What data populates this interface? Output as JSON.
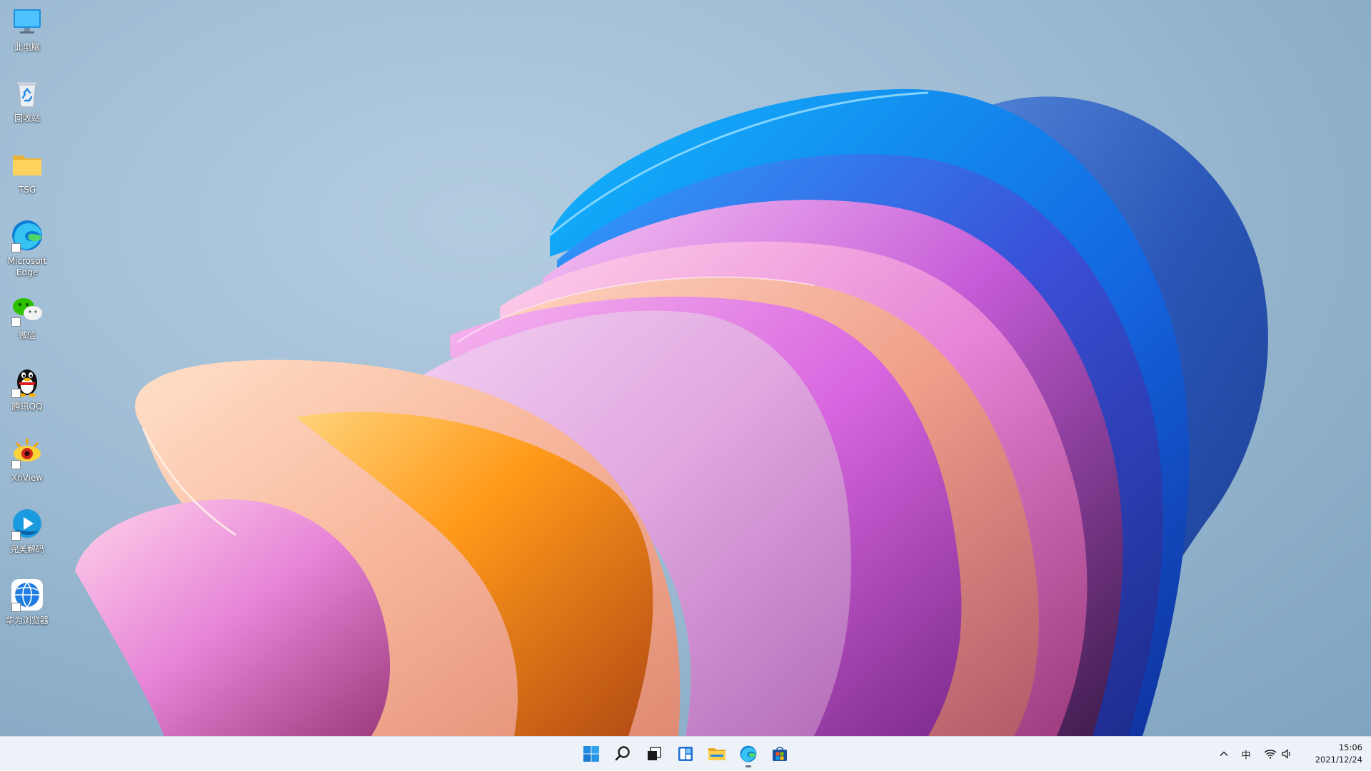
{
  "desktop": {
    "icons": [
      {
        "label": "此电脑",
        "icon": "computer-icon",
        "shortcut": false
      },
      {
        "label": "回收站",
        "icon": "recycle-bin-icon",
        "shortcut": false
      },
      {
        "label": "TSG",
        "icon": "folder-icon",
        "shortcut": false
      },
      {
        "label": "Microsoft Edge",
        "icon": "edge-icon",
        "shortcut": true
      },
      {
        "label": "微信",
        "icon": "wechat-icon",
        "shortcut": true
      },
      {
        "label": "腾讯QQ",
        "icon": "qq-icon",
        "shortcut": true
      },
      {
        "label": "XnView",
        "icon": "xnview-icon",
        "shortcut": true
      },
      {
        "label": "完美解码",
        "icon": "potplayer-icon",
        "shortcut": true
      },
      {
        "label": "华为浏览器",
        "icon": "huawei-browser-icon",
        "shortcut": true
      }
    ]
  },
  "taskbar": {
    "pinned": [
      {
        "name": "start",
        "icon": "windows-start-icon",
        "running": false
      },
      {
        "name": "search",
        "icon": "search-icon",
        "running": false
      },
      {
        "name": "task-view",
        "icon": "task-view-icon",
        "running": false
      },
      {
        "name": "widgets",
        "icon": "widgets-icon",
        "running": false
      },
      {
        "name": "file-explorer",
        "icon": "file-explorer-icon",
        "running": false
      },
      {
        "name": "edge",
        "icon": "edge-icon",
        "running": true
      },
      {
        "name": "store",
        "icon": "microsoft-store-icon",
        "running": false
      }
    ],
    "tray": {
      "overflow_icon": "chevron-up-icon",
      "input_method": "中",
      "network_icon": "wifi-icon",
      "volume_icon": "speaker-icon",
      "time": "15:06",
      "date": "2021/12/24"
    }
  },
  "colors": {
    "background": "#a4c0d7",
    "taskbar": "#ecf1f7",
    "accent": "#0078d4"
  }
}
